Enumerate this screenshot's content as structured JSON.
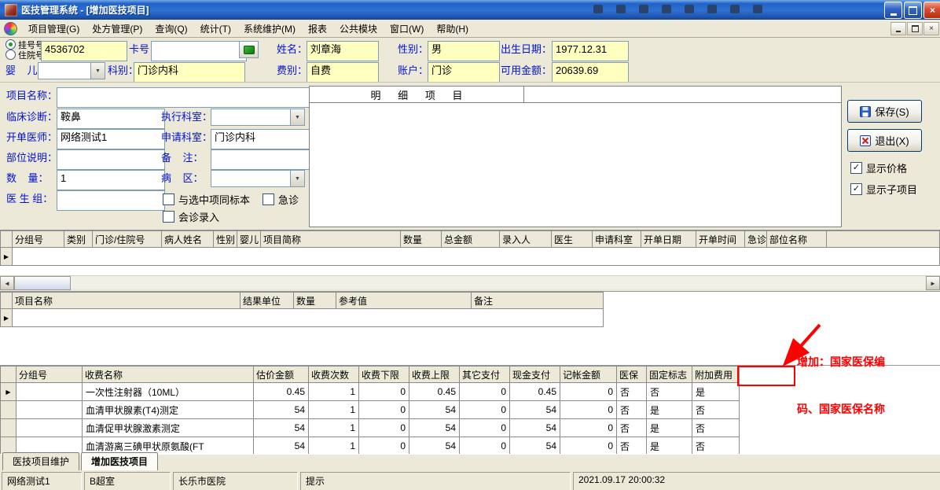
{
  "titlebar": {
    "title": "医技管理系统 - [增加医技项目]"
  },
  "menubar": {
    "items": [
      "项目管理(G)",
      "处方管理(P)",
      "查询(Q)",
      "统计(T)",
      "系统维护(M)",
      "报表",
      "公共模块",
      "窗口(W)",
      "帮助(H)"
    ]
  },
  "patient": {
    "radio_reg": "挂号号",
    "radio_inpatient": "住院号",
    "reg_no": "4536702",
    "card_label": "卡号",
    "card_no": "",
    "name_label": "姓名：",
    "name": "刘章海",
    "gender_label": "性别：",
    "gender": "男",
    "birth_label": "出生日期：",
    "birth_date": "1977.12.31",
    "infant_label": "婴    儿：",
    "infant": "",
    "dept_label": "科别：",
    "dept": "门诊内科",
    "fee_type_label": "费别：",
    "fee_type": "自费",
    "account_label": "账户：",
    "account": "门诊",
    "balance_label": "可用金额：",
    "balance": "20639.69"
  },
  "form": {
    "project_name_label": "项目名称：",
    "project_name": "",
    "diagnosis_label": "临床诊断：",
    "diagnosis": "鞍鼻",
    "exec_dept_label": "执行科室：",
    "exec_dept": "",
    "order_doctor_label": "开单医师：",
    "order_doctor": "网络测试1",
    "apply_dept_label": "申请科室：",
    "apply_dept": "门诊内科",
    "part_label": "部位说明：",
    "part": "",
    "remark_label": "备    注：",
    "remark": "",
    "qty_label": "数    量：",
    "qty": "1",
    "ward_label": "病    区：",
    "ward": "",
    "doctor_group_label": "医 生 组：",
    "doctor_group": "",
    "chk_same_specimen": "与选中项同标本",
    "chk_emergency": "急诊",
    "chk_consult": "会诊录入"
  },
  "detail_panel": {
    "header": "明      细      项      目"
  },
  "actions": {
    "save": "保存(S)",
    "exit": "退出(X)",
    "show_price": "显示价格",
    "show_sub_items": "显示子项目"
  },
  "state": {
    "registration_radio_selected": true,
    "inpatient_radio_selected": false,
    "same_specimen_checked": false,
    "emergency_checked": false,
    "consult_entry_checked": false,
    "show_price_checked": true,
    "show_sub_items_checked": true,
    "active_tab": "增加医技项目"
  },
  "order_grid": {
    "headers": [
      "分组号",
      "类别",
      "门诊/住院号",
      "病人姓名",
      "性别",
      "婴儿",
      "项目简称",
      "数量",
      "总金额",
      "录入人",
      "医生",
      "申请科室",
      "开单日期",
      "开单时间",
      "急诊",
      "部位名称"
    ]
  },
  "result_grid": {
    "headers": [
      "项目名称",
      "结果单位",
      "数量",
      "参考值",
      "备注"
    ]
  },
  "charge_grid": {
    "headers": [
      "分组号",
      "收费名称",
      "估价金额",
      "收费次数",
      "收费下限",
      "收费上限",
      "其它支付",
      "现金支付",
      "记帐金额",
      "医保",
      "固定标志",
      "附加费用"
    ],
    "rows": [
      [
        "",
        "一次性注射器（10ML）",
        "0.45",
        "1",
        "0",
        "0.45",
        "0",
        "0.45",
        "0",
        "否",
        "否",
        "是"
      ],
      [
        "",
        "血清甲状腺素(T4)测定",
        "54",
        "1",
        "0",
        "54",
        "0",
        "54",
        "0",
        "否",
        "是",
        "否"
      ],
      [
        "",
        "血清促甲状腺激素测定",
        "54",
        "1",
        "0",
        "54",
        "0",
        "54",
        "0",
        "否",
        "是",
        "否"
      ],
      [
        "",
        "血清游离三碘甲状原氨酸(FT",
        "54",
        "1",
        "0",
        "54",
        "0",
        "54",
        "0",
        "否",
        "是",
        "否"
      ]
    ]
  },
  "annotation": {
    "line1": "增加：国家医保编",
    "line2": "码、国家医保名称"
  },
  "tabs": {
    "items": [
      "医技项目维护",
      "增加医技项目"
    ],
    "active_index": 1
  },
  "statusbar": {
    "user": "网络测试1",
    "room": "B超室",
    "hospital": "长乐市医院",
    "hint": "提示",
    "timestamp": "2021.09.17 20:00:32"
  },
  "icons": {
    "check_icon": "✓",
    "dropdown_icon": "▼",
    "row_pointer_icon": "▶",
    "scroll_left_icon": "◄",
    "scroll_right_icon": "►",
    "close_icon": "×",
    "app_icon": "hospital-app",
    "save_icon": "floppy-disk",
    "exit_icon": "red-x",
    "card_read_icon": "card-reader"
  },
  "colors": {
    "titlebar_blue": "#2e6fd3",
    "label_blue": "#0011d4",
    "field_yellow": "#ffffc0",
    "annotation_red": "#ff0000",
    "panel_gray": "#ece9d8"
  }
}
